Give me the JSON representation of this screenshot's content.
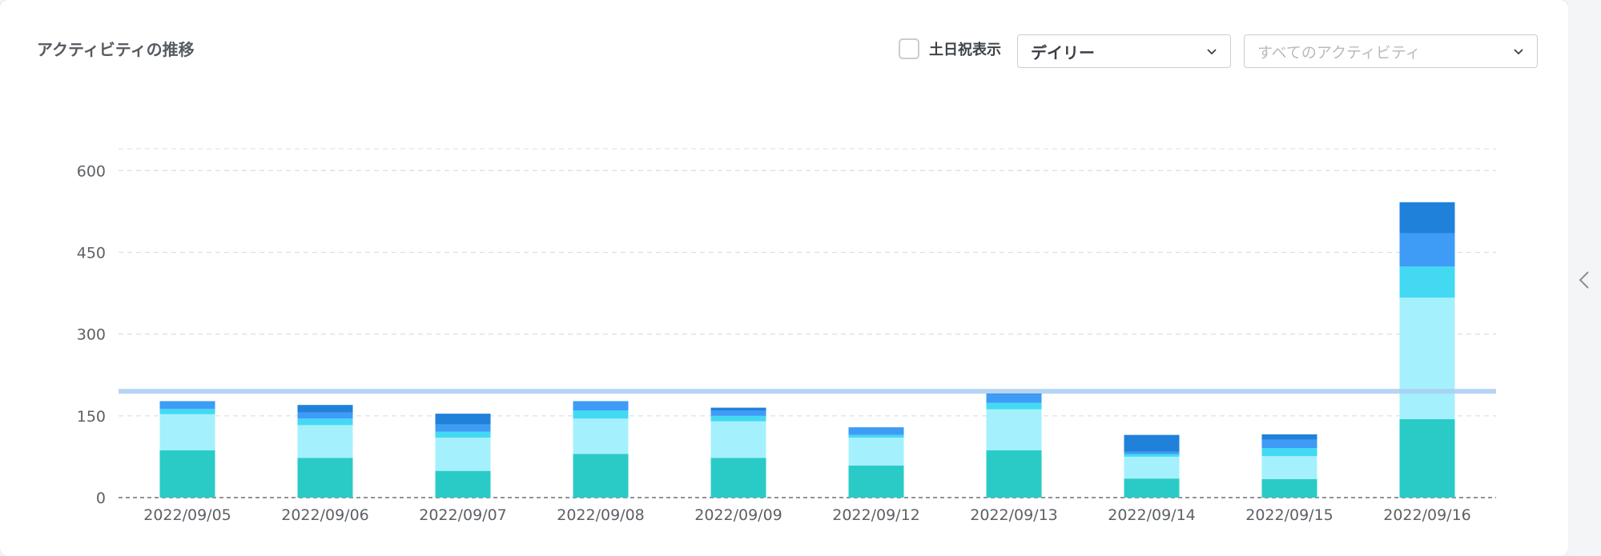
{
  "title": "アクティビティの推移",
  "controls": {
    "weekend_label": "土日祝表示",
    "weekend_checked": false,
    "period_value": "デイリー",
    "activity_placeholder": "すべてのアクティビティ"
  },
  "icons": {
    "period_chevron": "chevron-down-icon",
    "activity_chevron": "chevron-down-icon",
    "side_panel": "chevron-left-icon"
  },
  "chart_data": {
    "type": "bar",
    "stacked": true,
    "categories": [
      "2022/09/05",
      "2022/09/06",
      "2022/09/07",
      "2022/09/08",
      "2022/09/09",
      "2022/09/12",
      "2022/09/13",
      "2022/09/14",
      "2022/09/15",
      "2022/09/16"
    ],
    "series": [
      {
        "color": "#2acbc7",
        "values": [
          87,
          73,
          49,
          80,
          73,
          59,
          87,
          35,
          34,
          144
        ]
      },
      {
        "color": "#a5f0fd",
        "values": [
          66,
          60,
          61,
          65,
          67,
          51,
          75,
          40,
          42,
          223
        ]
      },
      {
        "color": "#43d9f3",
        "values": [
          10,
          12,
          11,
          15,
          10,
          5,
          12,
          5,
          15,
          57
        ]
      },
      {
        "color": "#3e9bf6",
        "values": [
          14,
          11,
          13,
          17,
          10,
          14,
          15,
          4,
          15,
          61
        ]
      },
      {
        "color": "#2081da",
        "values": [
          0,
          14,
          20,
          0,
          5,
          0,
          2,
          31,
          10,
          57
        ]
      }
    ],
    "y_ticks": [
      0,
      150,
      300,
      450,
      600
    ],
    "ylim": [
      0,
      640
    ],
    "reference_line": 195,
    "reference_color": "#a9cef3",
    "grid": "dashed horizontal",
    "legend": "none"
  }
}
